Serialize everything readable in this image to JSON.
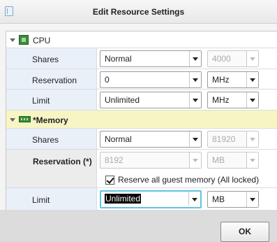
{
  "window": {
    "title": "Edit Resource Settings"
  },
  "cpu": {
    "section_label": "CPU",
    "shares": {
      "label": "Shares",
      "value": "Normal",
      "number": "4000"
    },
    "reservation": {
      "label": "Reservation",
      "value": "0",
      "unit": "MHz"
    },
    "limit": {
      "label": "Limit",
      "value": "Unlimited",
      "unit": "MHz"
    }
  },
  "memory": {
    "section_label": "*Memory",
    "shares": {
      "label": "Shares",
      "value": "Normal",
      "number": "81920"
    },
    "reservation": {
      "label": "Reservation (*)",
      "value": "8192",
      "unit": "MB",
      "checkbox_label": "Reserve all guest memory (All locked)",
      "checked": true
    },
    "limit": {
      "label": "Limit",
      "value": "Unlimited",
      "unit": "MB"
    }
  },
  "footer": {
    "ok_label": "OK"
  },
  "colors": {
    "memory_highlight": "#f7f5c4",
    "label_column": "#e9f0f8",
    "focus_ring": "#63c3de"
  },
  "icons": [
    "dialog-icon",
    "cpu-icon",
    "memory-icon",
    "expand-arrow-icon",
    "dropdown-arrow-icon",
    "checkmark-icon"
  ]
}
